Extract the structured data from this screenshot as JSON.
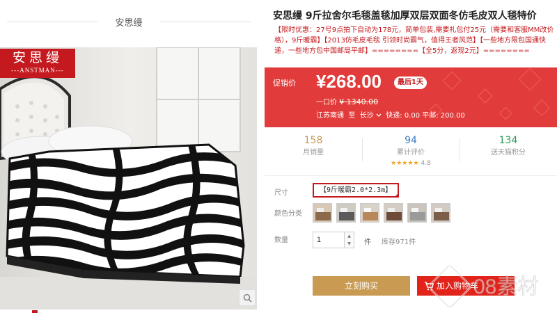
{
  "store": {
    "name": "安思缦"
  },
  "brand_badge": {
    "cn": "安思缦",
    "en": "---ANSTMAN---"
  },
  "product": {
    "title": "安思缦 9斤拉舍尔毛毯盖毯加厚双层双面冬仿毛皮双人毯特价",
    "promo": "【限时优惠：27号9点拍下自动为178元，简单包装,需要礼包付25元（需要和客服MM改价格），9斤暖霸】【2013仿毛皮毛毯 引领时尚霸气，值得王者风范】【一些地方限包国通快递，一些地方包中国邮局平邮】========【全5分，返现2元】========"
  },
  "price": {
    "label": "促销价",
    "value": "¥268.00",
    "badge": "最后1天",
    "original_label": "一口价",
    "original_value": "¥ 1340.00",
    "ship_from": "江苏南通",
    "ship_to_word": "至",
    "ship_dest": "长沙",
    "ship_info": "快递: 0.00  平邮: 200.00",
    "accent": "#e23b3b"
  },
  "stats": [
    {
      "num": "158",
      "label": "月销量",
      "color": "#c89a52"
    },
    {
      "num": "94",
      "label": "累计评价",
      "color": "#3a7dc9",
      "score": "4.8"
    },
    {
      "num": "134",
      "label": "送天猫积分",
      "color": "#2e9a57"
    }
  ],
  "options": {
    "size_label": "尺寸",
    "size_value": "【9斤暖霸2.0*2.3m】",
    "color_label": "颜色分类",
    "qty_label": "数量",
    "qty_value": "1",
    "qty_unit": "件",
    "stock": "库存971件"
  },
  "buttons": {
    "buy_now": "立刻购买",
    "add_cart": "加入购物车"
  },
  "watermark": {
    "text": "08素材"
  }
}
